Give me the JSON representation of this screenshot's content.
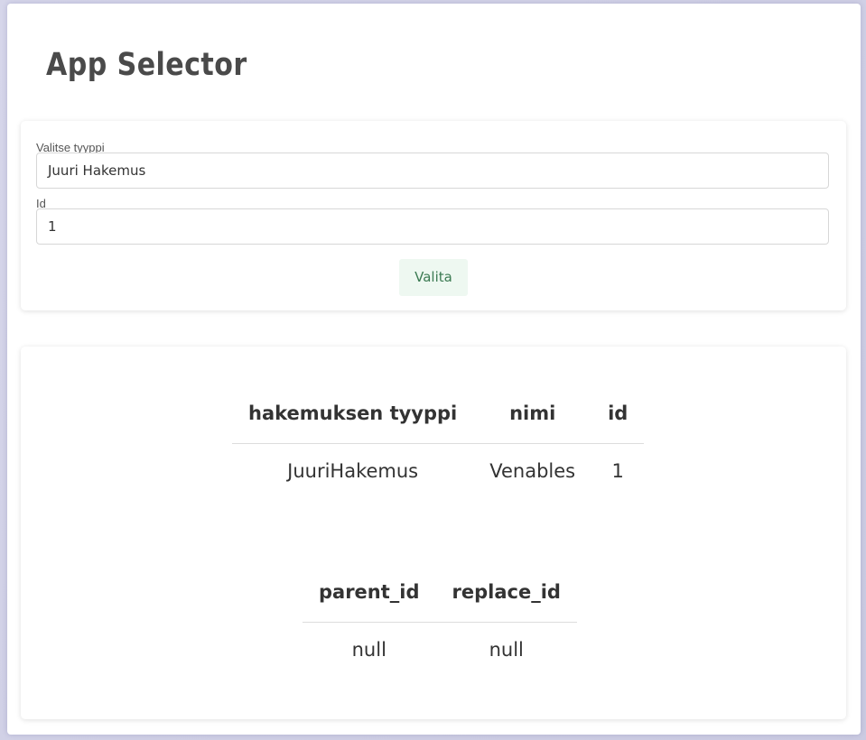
{
  "app": {
    "title": "App Selector"
  },
  "form": {
    "type_label": "Valitse tyyppi",
    "type_value": "Juuri Hakemus",
    "id_label": "Id",
    "id_value": "1",
    "select_button_label": "Valita"
  },
  "main_table": {
    "headers": [
      "hakemuksen tyyppi",
      "nimi",
      "id"
    ],
    "rows": [
      [
        "JuuriHakemus",
        "Venables",
        "1"
      ]
    ]
  },
  "relation_table": {
    "headers": [
      "parent_id",
      "replace_id"
    ],
    "rows": [
      [
        "null",
        "null"
      ]
    ]
  },
  "colors": {
    "background": "#cfcfe5",
    "button_bg": "#eef8f1",
    "button_text": "#3b7a52",
    "title_text": "#4a4a4a"
  }
}
